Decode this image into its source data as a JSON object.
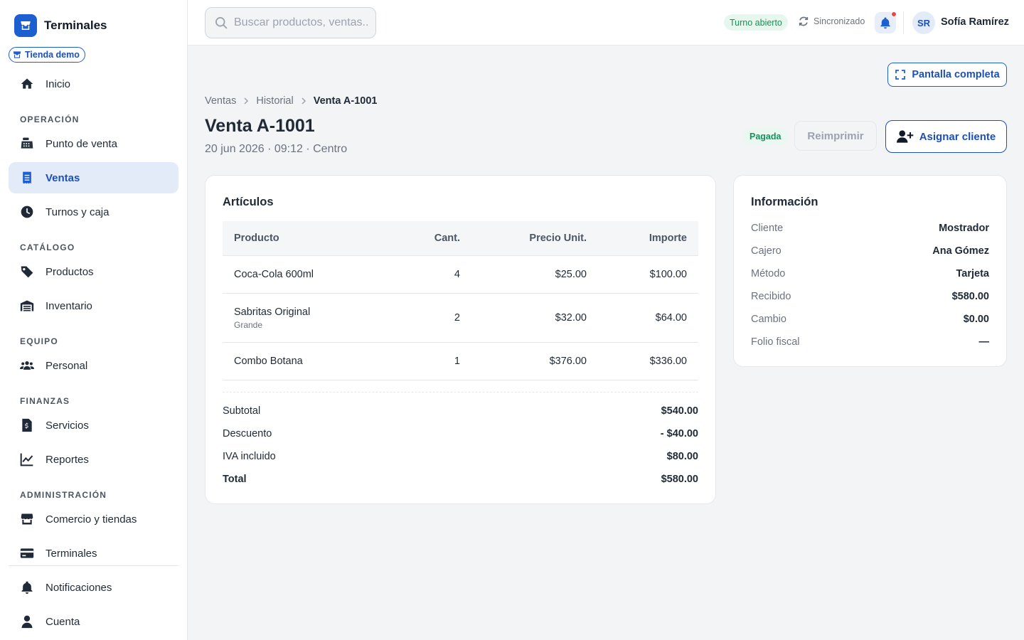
{
  "brand": {
    "name": "Terminales",
    "store": "Tienda demo"
  },
  "nav": {
    "home": "Inicio",
    "sections": {
      "operacion": "OPERACIÓN",
      "catalogo": "CATÁLOGO",
      "equipo": "EQUIPO",
      "finanzas": "FINANZAS",
      "admin": "ADMINISTRACIÓN"
    },
    "items": {
      "pos": "Punto de venta",
      "ventas": "Ventas",
      "turnos": "Turnos y caja",
      "productos": "Productos",
      "inventario": "Inventario",
      "personal": "Personal",
      "servicios": "Servicios",
      "reportes": "Reportes",
      "comercio": "Comercio y tiendas",
      "terminales": "Terminales",
      "notificaciones": "Notificaciones",
      "cuenta": "Cuenta"
    },
    "active": "ventas"
  },
  "topbar": {
    "search_placeholder": "Buscar productos, ventas...",
    "shift_status": "Turno abierto",
    "sync_status": "Sincronizado",
    "user_initials": "SR",
    "user_name": "Sofía Ramírez"
  },
  "page": {
    "fullscreen_label": "Pantalla completa",
    "breadcrumb": [
      "Ventas",
      "Historial",
      "Venta A-1001"
    ],
    "title": "Venta A-1001",
    "subtitle": "20 jun 2026 · 09:12 · Centro",
    "status": "Pagada",
    "reprint_label": "Reimprimir",
    "assign_label": "Asignar cliente"
  },
  "items_card": {
    "title": "Artículos",
    "columns": [
      "Producto",
      "Cant.",
      "Precio Unit.",
      "Importe"
    ],
    "rows": [
      {
        "product": "Coca-Cola 600ml",
        "variant": "",
        "qty": "4",
        "price": "$25.00",
        "amount": "$100.00"
      },
      {
        "product": "Sabritas Original",
        "variant": "Grande",
        "qty": "2",
        "price": "$32.00",
        "amount": "$64.00"
      },
      {
        "product": "Combo Botana",
        "variant": "",
        "qty": "1",
        "price": "$376.00",
        "amount": "$336.00"
      }
    ],
    "summary": {
      "subtotal_label": "Subtotal",
      "subtotal": "$540.00",
      "discount_label": "Descuento",
      "discount": "- $40.00",
      "tax_label": "IVA incluido",
      "tax": "$80.00",
      "total_label": "Total",
      "total": "$580.00"
    }
  },
  "info_card": {
    "title": "Información",
    "rows": [
      {
        "label": "Cliente",
        "value": "Mostrador"
      },
      {
        "label": "Cajero",
        "value": "Ana Gómez"
      },
      {
        "label": "Método",
        "value": "Tarjeta"
      },
      {
        "label": "Recibido",
        "value": "$580.00"
      },
      {
        "label": "Cambio",
        "value": "$0.00"
      },
      {
        "label": "Folio fiscal",
        "value": "—"
      }
    ]
  },
  "colors": {
    "accent": "#1d5fd1",
    "success": "#14935a",
    "danger": "#ef4444"
  }
}
